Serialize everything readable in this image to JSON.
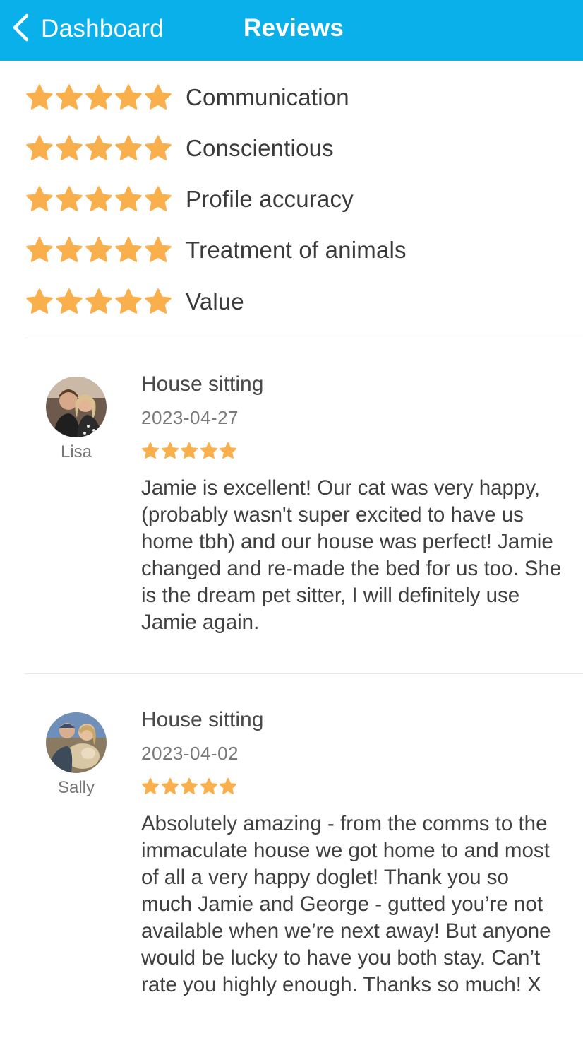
{
  "nav": {
    "back_label": "Dashboard",
    "title": "Reviews",
    "back_icon": "chevron-left-icon",
    "bar_color": "#0ab0ea"
  },
  "star_color": "#f9b04c",
  "ratings": [
    {
      "label": "Communication",
      "stars": 5
    },
    {
      "label": "Conscientious",
      "stars": 5
    },
    {
      "label": "Profile accuracy",
      "stars": 5
    },
    {
      "label": "Treatment of animals",
      "stars": 5
    },
    {
      "label": "Value",
      "stars": 5
    }
  ],
  "reviews": [
    {
      "reviewer": "Lisa",
      "type": "House sitting",
      "date": "2023-04-27",
      "stars": 5,
      "text": "Jamie is excellent! Our cat was very happy, (probably wasn't super excited to have us home tbh) and our house was perfect! Jamie changed and re-made the bed for us too.  She is the dream pet sitter, I will definitely use Jamie again."
    },
    {
      "reviewer": "Sally",
      "type": "House sitting",
      "date": "2023-04-02",
      "stars": 5,
      "text": "Absolutely amazing - from the comms to the immaculate house we got home to and most of all a very happy doglet! Thank you so much Jamie and George - gutted you’re not available when we’re next away! But anyone would be lucky to have you both stay. Can’t rate you highly enough. Thanks so much! X"
    }
  ]
}
